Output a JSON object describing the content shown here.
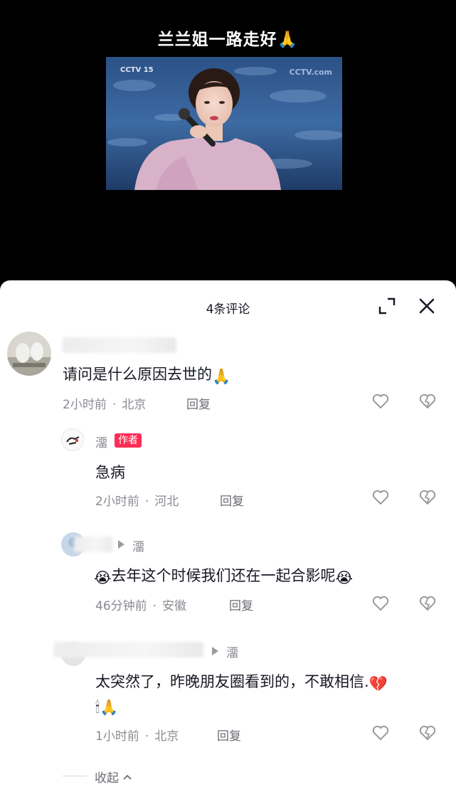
{
  "video": {
    "title": "兰兰姐一路走好🙏",
    "channel_logo": "CCTV 15",
    "watermark": "CCTV.com"
  },
  "panel": {
    "count_label": "4条评论",
    "expand_icon": "expand-icon",
    "close_icon": "close-icon"
  },
  "comments": [
    {
      "text": "请问是什么原因去世的",
      "emoji": "🙏",
      "time": "2小时前",
      "location": "北京",
      "reply_label": "回复"
    }
  ],
  "replies": [
    {
      "user": "澑",
      "badge": "作者",
      "text": "急病",
      "time": "2小时前",
      "location": "河北",
      "reply_label": "回复"
    },
    {
      "reply_to": "澑",
      "emoji_start": "😭",
      "text": "去年这个时候我们还在一起合影呢",
      "emoji_end": "😭",
      "time": "46分钟前",
      "location": "安徽",
      "reply_label": "回复"
    },
    {
      "reply_to": "澑",
      "text": "太突然了，昨晚朋友圈看到的，不敢相信.",
      "emoji_broken_heart": "💔",
      "emoji_line2": "🕯🙏",
      "time": "1小时前",
      "location": "北京",
      "reply_label": "回复"
    }
  ],
  "collapse_label": "收起",
  "colors": {
    "accent": "#fe2c55",
    "text": "#161823",
    "meta": "#8a8b91"
  }
}
